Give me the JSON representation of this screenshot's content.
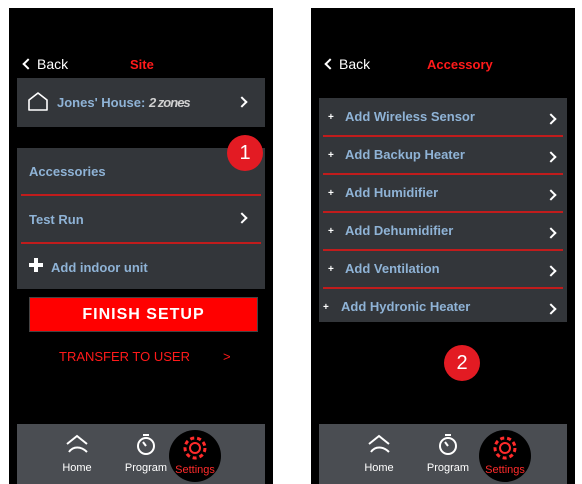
{
  "left_screen": {
    "back_label": "Back",
    "title": "Site",
    "house": {
      "name": "Jones' House:",
      "zones": "2 zones"
    },
    "menu": {
      "accessories": "Accessories",
      "test_run": "Test Run",
      "add_indoor_unit": "Add indoor unit"
    },
    "finish_setup": "FINISH SETUP",
    "transfer": "TRANSFER TO USER",
    "transfer_chevron": ">",
    "badge": "1"
  },
  "right_screen": {
    "back_label": "Back",
    "title": "Accessory",
    "items": [
      "Add Wireless Sensor",
      "Add Backup Heater",
      "Add Humidifier",
      "Add Dehumidifier",
      "Add Ventilation",
      "Add Hydronic Heater"
    ],
    "badge": "2"
  },
  "nav": {
    "home": "Home",
    "program": "Program",
    "settings": "Settings"
  },
  "colors": {
    "accent_red": "#ff1a1a",
    "item_blue": "#8fb3d6",
    "card_bg": "#33363a",
    "nav_bg": "#4a4d52"
  }
}
